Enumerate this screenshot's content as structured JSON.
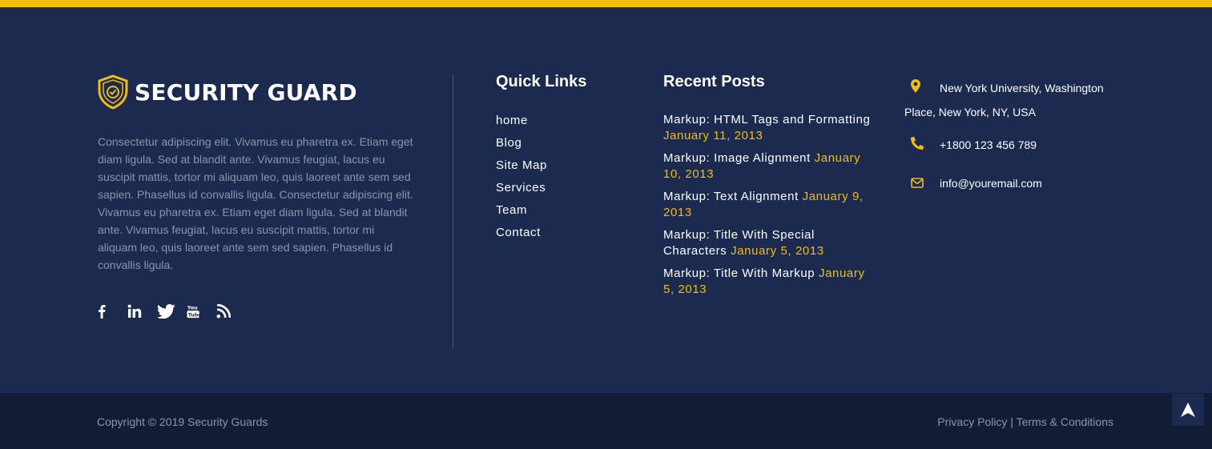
{
  "brand": {
    "name": "SECURITY GUARD",
    "accent": "#f0bd13"
  },
  "about": {
    "text": "Consectetur adipiscing elit. Vivamus eu pharetra ex. Etiam eget diam ligula. Sed at blandit ante. Vivamus feugiat, lacus eu suscipit mattis, tortor mi aliquam leo, quis laoreet ante sem sed sapien. Phasellus id convallis ligula. Consectetur adipiscing elit. Vivamus eu pharetra ex. Etiam eget diam ligula. Sed at blandit ante. Vivamus feugiat, lacus eu suscipit mattis, tortor mi aliquam leo, quis laoreet ante sem sed sapien. Phasellus id convallis ligula."
  },
  "social": [
    "facebook-icon",
    "linkedin-icon",
    "twitter-icon",
    "youtube-icon",
    "rss-icon"
  ],
  "quick_links": {
    "title": "Quick Links",
    "items": [
      "home",
      "Blog",
      "Site Map",
      "Services",
      "Team",
      "Contact"
    ]
  },
  "recent_posts": {
    "title": "Recent Posts",
    "items": [
      {
        "title": "Markup: HTML Tags and Formatting",
        "date": "January 11, 2013"
      },
      {
        "title": "Markup: Image Alignment",
        "date": "January 10, 2013"
      },
      {
        "title": "Markup: Text Alignment",
        "date": "January 9, 2013"
      },
      {
        "title": "Markup: Title With Special Characters",
        "date": "January 5, 2013"
      },
      {
        "title": "Markup: Title With Markup",
        "date": "January 5, 2013"
      }
    ]
  },
  "contact": {
    "address": "New York University, Washington Place, New York, NY, USA",
    "phone": "+1800 123 456 789",
    "email": "info@youremail.com"
  },
  "footer": {
    "copyright": "Copyright © 2019 Security Guards",
    "privacy": "Privacy Policy",
    "separator": "|",
    "terms": "Terms & Conditions"
  }
}
